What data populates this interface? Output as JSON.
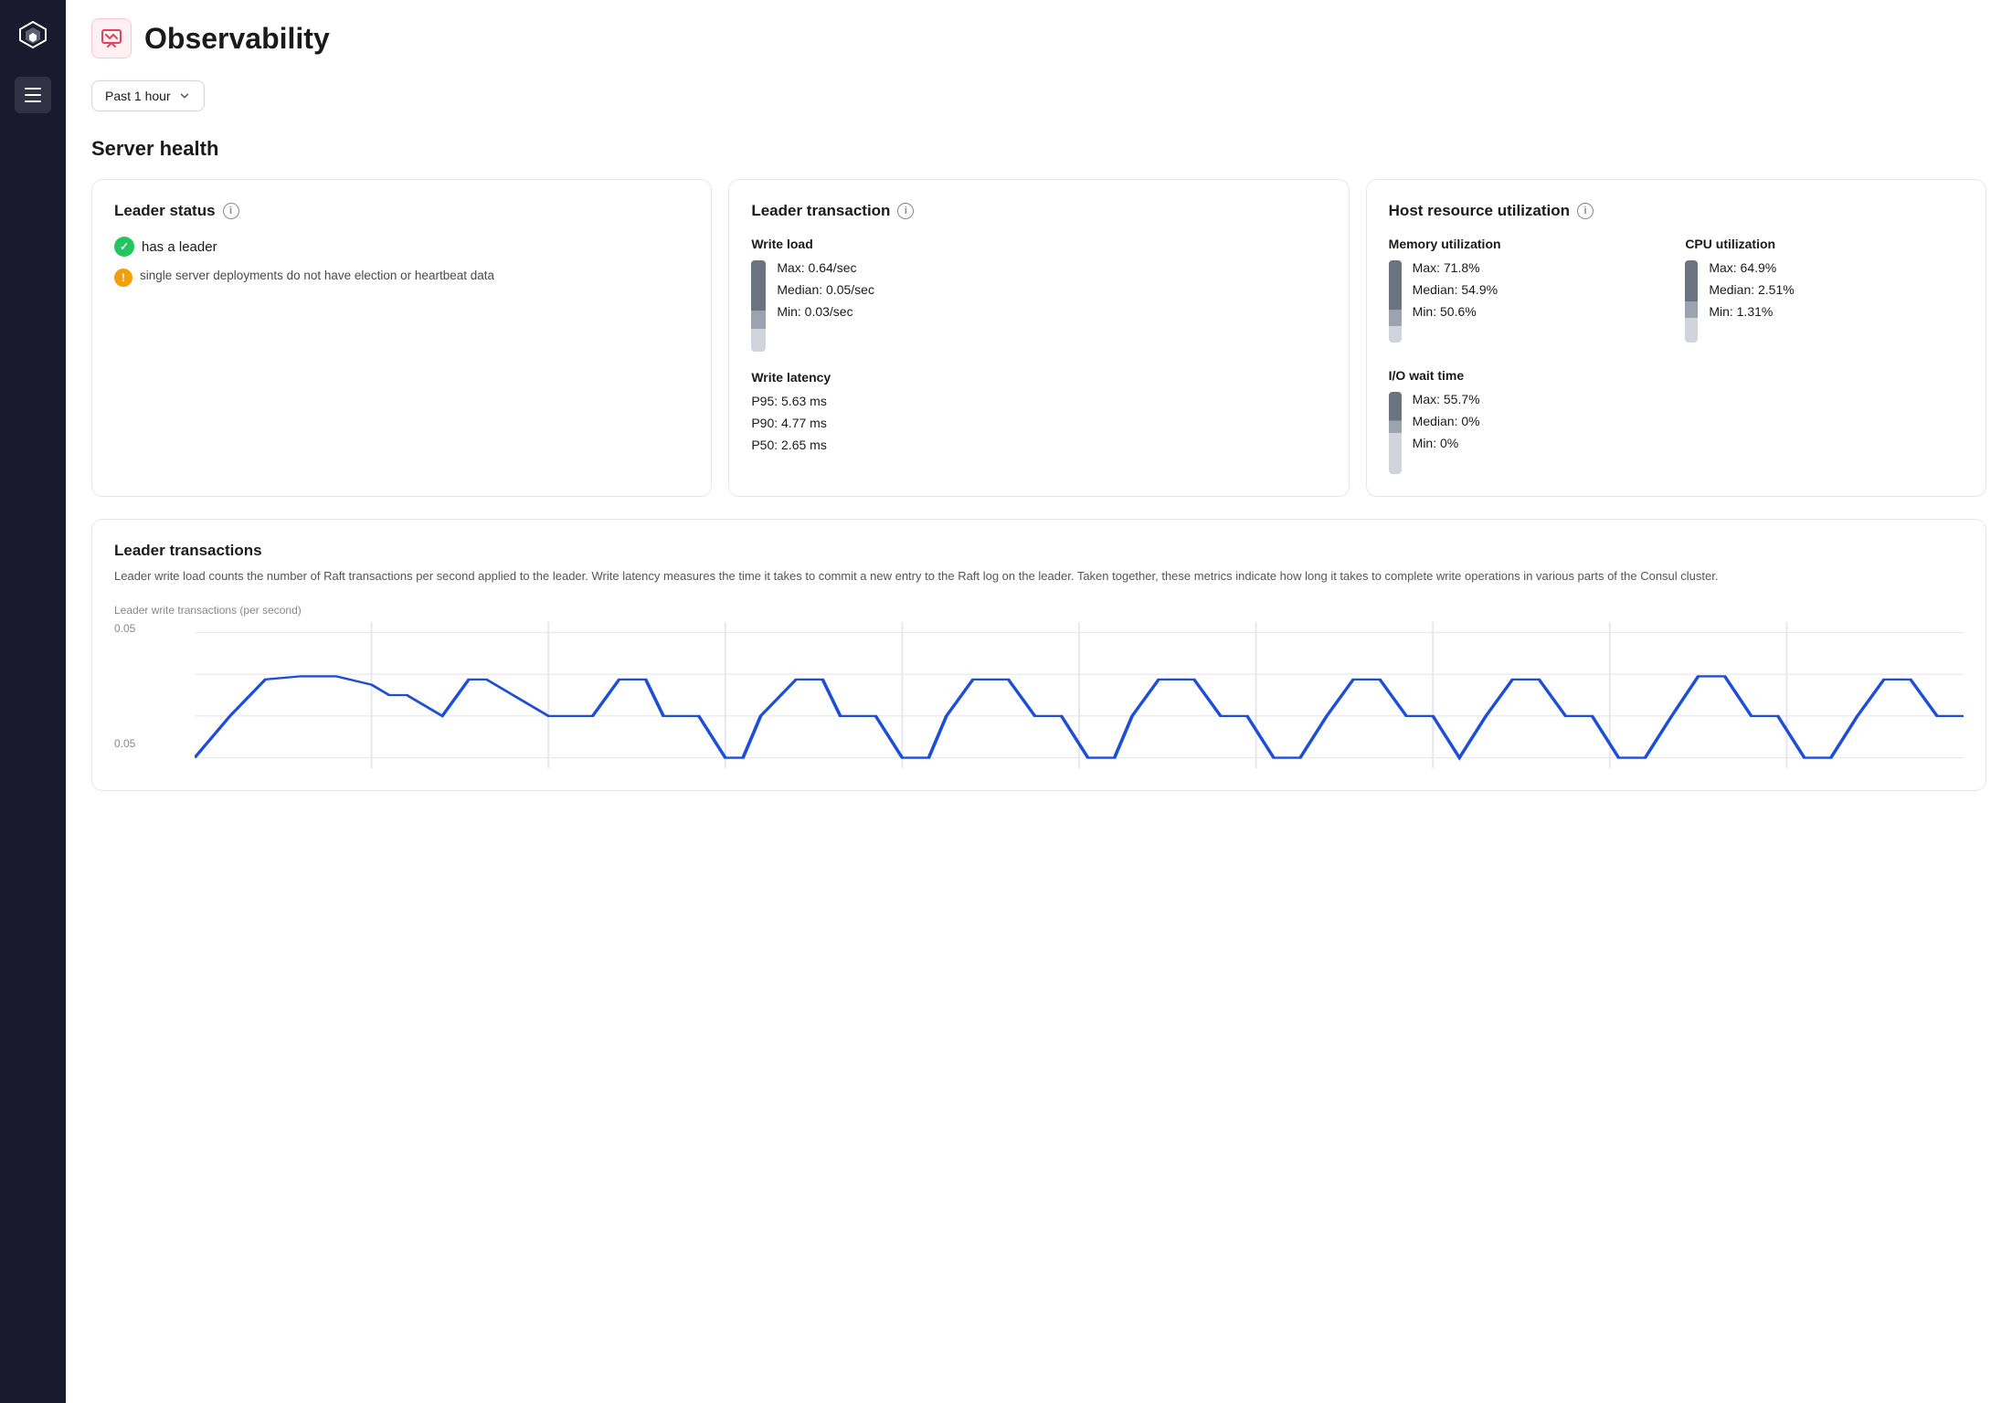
{
  "sidebar": {
    "logo_alt": "HashiCorp logo"
  },
  "header": {
    "icon": "📈",
    "title": "Observability"
  },
  "toolbar": {
    "time_select_label": "Past 1 hour",
    "chevron": "▾"
  },
  "server_health": {
    "section_title": "Server health",
    "leader_status": {
      "card_title": "Leader status",
      "has_leader_text": "has a leader",
      "warning_text": "single server deployments do not have election or heartbeat data"
    },
    "leader_transaction": {
      "card_title": "Leader transaction",
      "write_load_title": "Write load",
      "write_load_max": "Max: 0.64/sec",
      "write_load_median": "Median: 0.05/sec",
      "write_load_min": "Min: 0.03/sec",
      "write_latency_title": "Write latency",
      "write_latency_p95": "P95: 5.63 ms",
      "write_latency_p90": "P90: 4.77 ms",
      "write_latency_p50": "P50: 2.65 ms"
    },
    "host_resource": {
      "card_title": "Host resource utilization",
      "memory_title": "Memory utilization",
      "memory_max": "Max: 71.8%",
      "memory_median": "Median: 54.9%",
      "memory_min": "Min: 50.6%",
      "cpu_title": "CPU utilization",
      "cpu_max": "Max: 64.9%",
      "cpu_median": "Median: 2.51%",
      "cpu_min": "Min: 1.31%",
      "io_title": "I/O wait time",
      "io_max": "Max: 55.7%",
      "io_median": "Median: 0%",
      "io_min": "Min: 0%"
    }
  },
  "leader_transactions_chart": {
    "title": "Leader transactions",
    "description": "Leader write load counts the number of Raft transactions per second applied to the leader. Write latency measures the time it takes to commit a new entry to the Raft log on the leader. Taken together, these metrics indicate how long it takes to complete write operations in various parts of the Consul cluster.",
    "chart_label": "Leader write transactions (per second)",
    "y_axis_top": "0.05",
    "y_axis_bottom": "0.05"
  }
}
